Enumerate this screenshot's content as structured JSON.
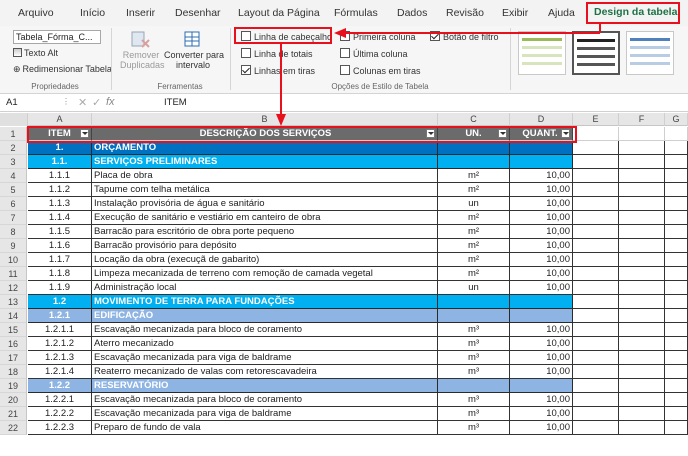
{
  "menu": {
    "tabs": [
      "Arquivo",
      "Início",
      "Inserir",
      "Desenhar",
      "Layout da Página",
      "Fórmulas",
      "Dados",
      "Revisão",
      "Exibir",
      "Ajuda",
      "Design da tabela"
    ]
  },
  "ribbon": {
    "table_name": "Tabela_Fórma_C...",
    "properties": {
      "alt_text": "Texto Alt",
      "resize": "Redimensionar Tabela",
      "label": "Propriedades"
    },
    "tools": {
      "remove_duplicates_line1": "Remover",
      "remove_duplicates_line2": "Duplicadas",
      "convert_line1": "Converter para",
      "convert_line2": "intervalo",
      "label": "Ferramentas"
    },
    "style_options": {
      "header_row": "Linha de cabeçalho",
      "total_row": "Linha de totais",
      "banded_rows": "Linhas em tiras",
      "first_column": "Primeira coluna",
      "last_column": "Última coluna",
      "banded_columns": "Colunas em tiras",
      "filter_button": "Botão de filtro",
      "label": "Opções de Estilo de Tabela",
      "states": {
        "header_row": false,
        "total_row": false,
        "banded_rows": true,
        "first_column": false,
        "last_column": false,
        "banded_columns": false,
        "filter_button": true
      }
    }
  },
  "formula_bar": {
    "cell_ref": "A1",
    "fx": "fx",
    "value": "ITEM"
  },
  "grid": {
    "columns": [
      "A",
      "B",
      "C",
      "D",
      "E",
      "F",
      "G"
    ],
    "header": {
      "item": "ITEM",
      "description": "DESCRIÇÃO DOS SERVIÇOS",
      "unit": "UN.",
      "qty": "QUANT."
    },
    "rows": [
      {
        "n": "2",
        "style": "dark",
        "a": "1.",
        "b": "ORÇAMENTO",
        "c": "",
        "d": ""
      },
      {
        "n": "3",
        "style": "light",
        "a": "1.1.",
        "b": "SERVIÇOS PRELIMINARES",
        "c": "",
        "d": ""
      },
      {
        "n": "4",
        "style": "",
        "a": "1.1.1",
        "b": "Placa de obra",
        "c": "m²",
        "d": "10,00"
      },
      {
        "n": "5",
        "style": "",
        "a": "1.1.2",
        "b": "Tapume com telha metálica",
        "c": "m²",
        "d": "10,00"
      },
      {
        "n": "6",
        "style": "",
        "a": "1.1.3",
        "b": "Instalação provisória de água e sanitário",
        "c": "un",
        "d": "10,00"
      },
      {
        "n": "7",
        "style": "",
        "a": "1.1.4",
        "b": "Execução de sanitário e vestiário em canteiro de obra",
        "c": "m²",
        "d": "10,00"
      },
      {
        "n": "8",
        "style": "",
        "a": "1.1.5",
        "b": "Barracão para escritório de obra porte pequeno",
        "c": "m²",
        "d": "10,00"
      },
      {
        "n": "9",
        "style": "",
        "a": "1.1.6",
        "b": "Barracão provisório para depósito",
        "c": "m²",
        "d": "10,00"
      },
      {
        "n": "10",
        "style": "",
        "a": "1.1.7",
        "b": "Locação da obra (execuçã de gabarito)",
        "c": "m²",
        "d": "10,00"
      },
      {
        "n": "11",
        "style": "",
        "a": "1.1.8",
        "b": "Limpeza mecanizada de terreno com remoção de camada vegetal",
        "c": "m²",
        "d": "10,00"
      },
      {
        "n": "12",
        "style": "",
        "a": "1.1.9",
        "b": "Administração local",
        "c": "un",
        "d": "10,00"
      },
      {
        "n": "13",
        "style": "light",
        "a": "1.2",
        "b": "MOVIMENTO DE TERRA PARA FUNDAÇÕES",
        "c": "",
        "d": ""
      },
      {
        "n": "14",
        "style": "grey",
        "a": "1.2.1",
        "b": "EDIFICAÇÃO",
        "c": "",
        "d": ""
      },
      {
        "n": "15",
        "style": "",
        "a": "1.2.1.1",
        "b": "Escavação mecanizada para bloco de coramento",
        "c": "m³",
        "d": "10,00"
      },
      {
        "n": "16",
        "style": "",
        "a": "1.2.1.2",
        "b": "Aterro mecanizado",
        "c": "m³",
        "d": "10,00"
      },
      {
        "n": "17",
        "style": "",
        "a": "1.2.1.3",
        "b": "Escavação mecanizada para viga de baldrame",
        "c": "m³",
        "d": "10,00"
      },
      {
        "n": "18",
        "style": "",
        "a": "1.2.1.4",
        "b": "Reaterro mecanizado de valas com retorescavadeira",
        "c": "m³",
        "d": "10,00"
      },
      {
        "n": "19",
        "style": "grey",
        "a": "1.2.2",
        "b": "RESERVATÓRIO",
        "c": "",
        "d": ""
      },
      {
        "n": "20",
        "style": "",
        "a": "1.2.2.1",
        "b": "Escavação mecanizada para bloco de coramento",
        "c": "m³",
        "d": "10,00"
      },
      {
        "n": "21",
        "style": "",
        "a": "1.2.2.2",
        "b": "Escavação mecanizada para viga de baldrame",
        "c": "m³",
        "d": "10,00"
      },
      {
        "n": "22",
        "style": "",
        "a": "1.2.2.3",
        "b": "Preparo de fundo de vala",
        "c": "m³",
        "d": "10,00"
      }
    ]
  },
  "colors": {
    "accent": "#1e7145",
    "annotation": "#e8101c",
    "dark_row": "#0070c0",
    "light_row": "#00b0f0",
    "grey_row": "#8eb4e3",
    "header_row": "#6b6b6b"
  }
}
